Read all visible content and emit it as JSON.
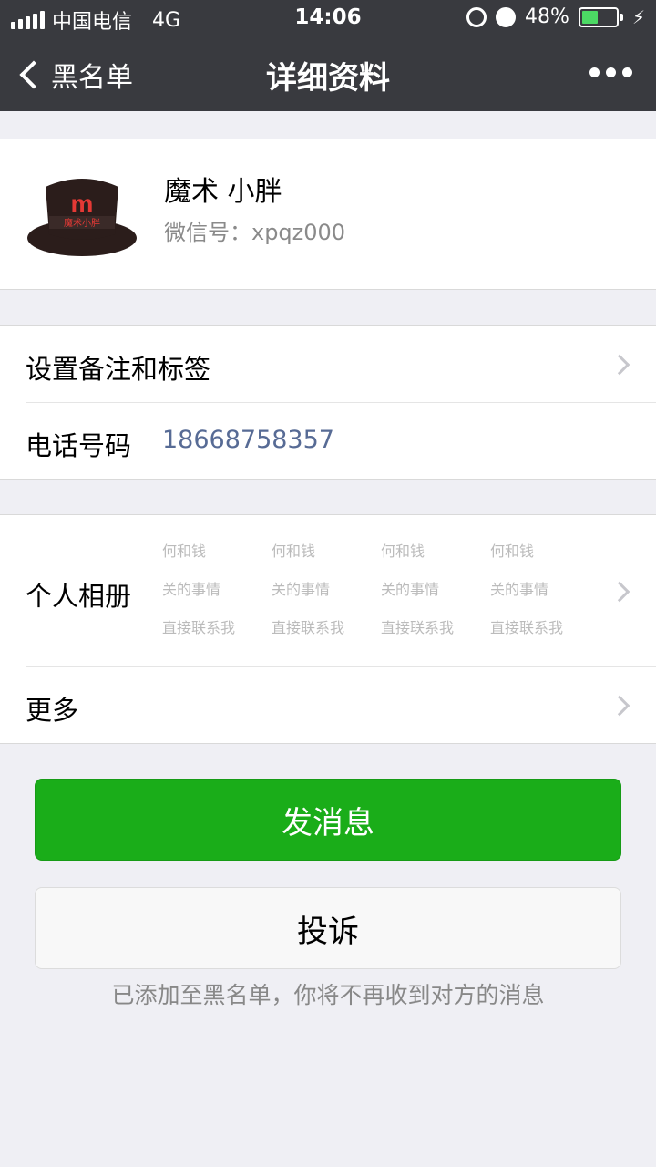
{
  "status_bar": {
    "carrier": "中国电信",
    "network": "4G",
    "time": "14:06",
    "battery": "48%",
    "battery_level": 0.48,
    "battery_color": "#4cd964"
  },
  "nav": {
    "back_label": "黑名单",
    "title": "详细资料",
    "more_icon": "more-dots-icon"
  },
  "profile": {
    "name": "魔术 小胖",
    "wechat_id": "微信号：xpqz000",
    "avatar_text": "魔术小胖",
    "avatar_mark": "m"
  },
  "settings": {
    "remark_label": "设置备注和标签",
    "phone_label": "电话号码",
    "phone_value": "18668758357"
  },
  "album": {
    "label": "个人相册",
    "thumbs": [
      [
        "何和钱",
        "关的事情",
        "直接联系我"
      ],
      [
        "何和钱",
        "关的事情",
        "直接联系我"
      ],
      [
        "何和钱",
        "关的事情",
        "直接联系我"
      ],
      [
        "何和钱",
        "关的事情",
        "直接联系我"
      ]
    ]
  },
  "more": {
    "label": "更多"
  },
  "actions": {
    "send_label": "发消息",
    "complain_label": "投诉",
    "notice": "已添加至黑名单，你将不再收到对方的消息"
  },
  "colors": {
    "nav_bg": "#393a3f",
    "primary_green": "#1aad19",
    "link_blue": "#576b95"
  }
}
